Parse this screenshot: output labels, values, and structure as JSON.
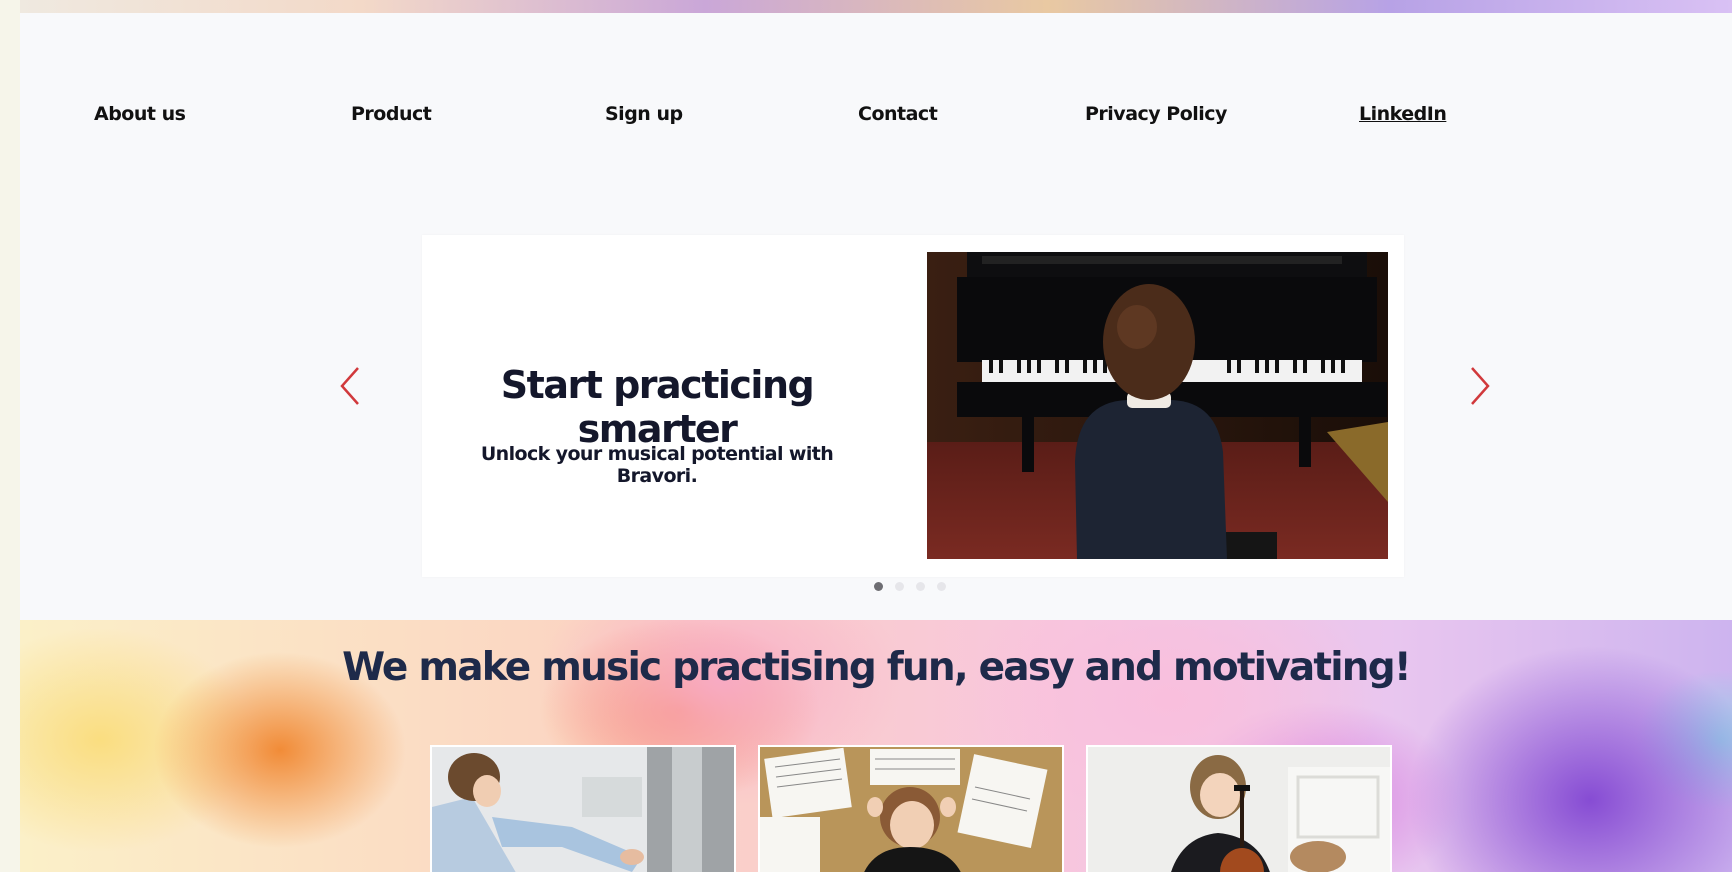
{
  "nav": {
    "items": [
      {
        "label": "About us"
      },
      {
        "label": "Product"
      },
      {
        "label": "Sign up"
      },
      {
        "label": "Contact"
      },
      {
        "label": "Privacy Policy"
      },
      {
        "label": "LinkedIn"
      }
    ]
  },
  "slider": {
    "title": "Start practicing smarter",
    "subtitle": "Unlock your musical potential with Bravori.",
    "photo_icon": "child-playing-piano-photo",
    "prev_icon": "chevron-left-icon",
    "next_icon": "chevron-right-icon",
    "arrow_color": "#d1393c",
    "dot_count": 4,
    "active_dot": 1
  },
  "features": {
    "heading": "We make music practising fun, easy and motivating!",
    "cards": [
      {
        "icon": "child-piano-lesson-photo"
      },
      {
        "icon": "child-sheet-music-photo"
      },
      {
        "icon": "child-cello-photo"
      }
    ]
  },
  "colors": {
    "heading_text": "#1e2a4a",
    "body_text": "#14172b",
    "page_bg": "#f8f9fb"
  }
}
